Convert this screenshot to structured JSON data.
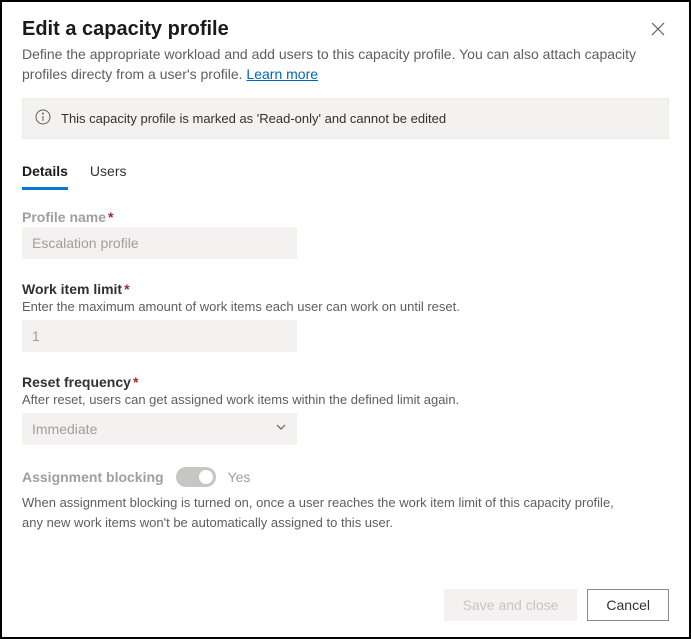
{
  "header": {
    "title": "Edit a capacity profile",
    "subtitle_a": "Define the appropriate workload and add users to this capacity profile. You can also attach capacity profiles directy from a user's profile. ",
    "learn_more": "Learn more"
  },
  "banner": {
    "text": "This capacity profile is marked as 'Read-only' and cannot be edited"
  },
  "tabs": {
    "details": "Details",
    "users": "Users"
  },
  "fields": {
    "profile_name": {
      "label": "Profile name",
      "value": "Escalation profile"
    },
    "work_item_limit": {
      "label": "Work item limit",
      "help": "Enter the maximum amount of work items each user can work on until reset.",
      "value": "1"
    },
    "reset_frequency": {
      "label": "Reset frequency",
      "help": "After reset, users can get assigned work items within the defined limit again.",
      "value": "Immediate"
    },
    "assignment_blocking": {
      "label": "Assignment blocking",
      "state": "Yes",
      "desc1": "When assignment blocking is turned on, once a user reaches the work item limit of this capacity profile,",
      "desc2": "any new work items won't be automatically assigned to this user."
    }
  },
  "footer": {
    "save": "Save and close",
    "cancel": "Cancel"
  }
}
